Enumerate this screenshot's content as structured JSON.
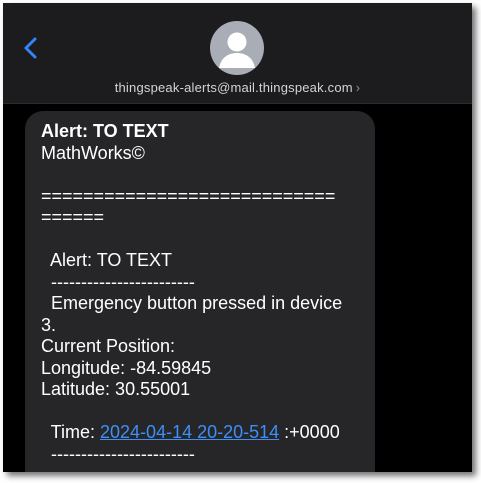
{
  "header": {
    "sender": "thingspeak-alerts@mail.thingspeak.com",
    "chevron": "›",
    "back_icon": "chevron-left-icon",
    "avatar_icon": "person-icon"
  },
  "message": {
    "subject": "Alert: TO TEXT",
    "company": "MathWorks©",
    "separator_1": "============================",
    "separator_2": "======",
    "alert_line": "  Alert: TO TEXT",
    "dash_line": "  ------------------------",
    "body_line_1": "  Emergency button pressed in device",
    "body_line_2": "3.",
    "position_label": "Current Position:",
    "longitude": "Longitude: -84.59845",
    "latitude": "Latitude: 30.55001",
    "time_label": "  Time: ",
    "time_link": "2024-04-14 20-20-514",
    "time_suffix": " :+0000",
    "dash_line_2": "  ------------------------"
  },
  "colors": {
    "link": "#3e8ff7",
    "bubble": "#262628",
    "header": "#1c1c1e"
  }
}
